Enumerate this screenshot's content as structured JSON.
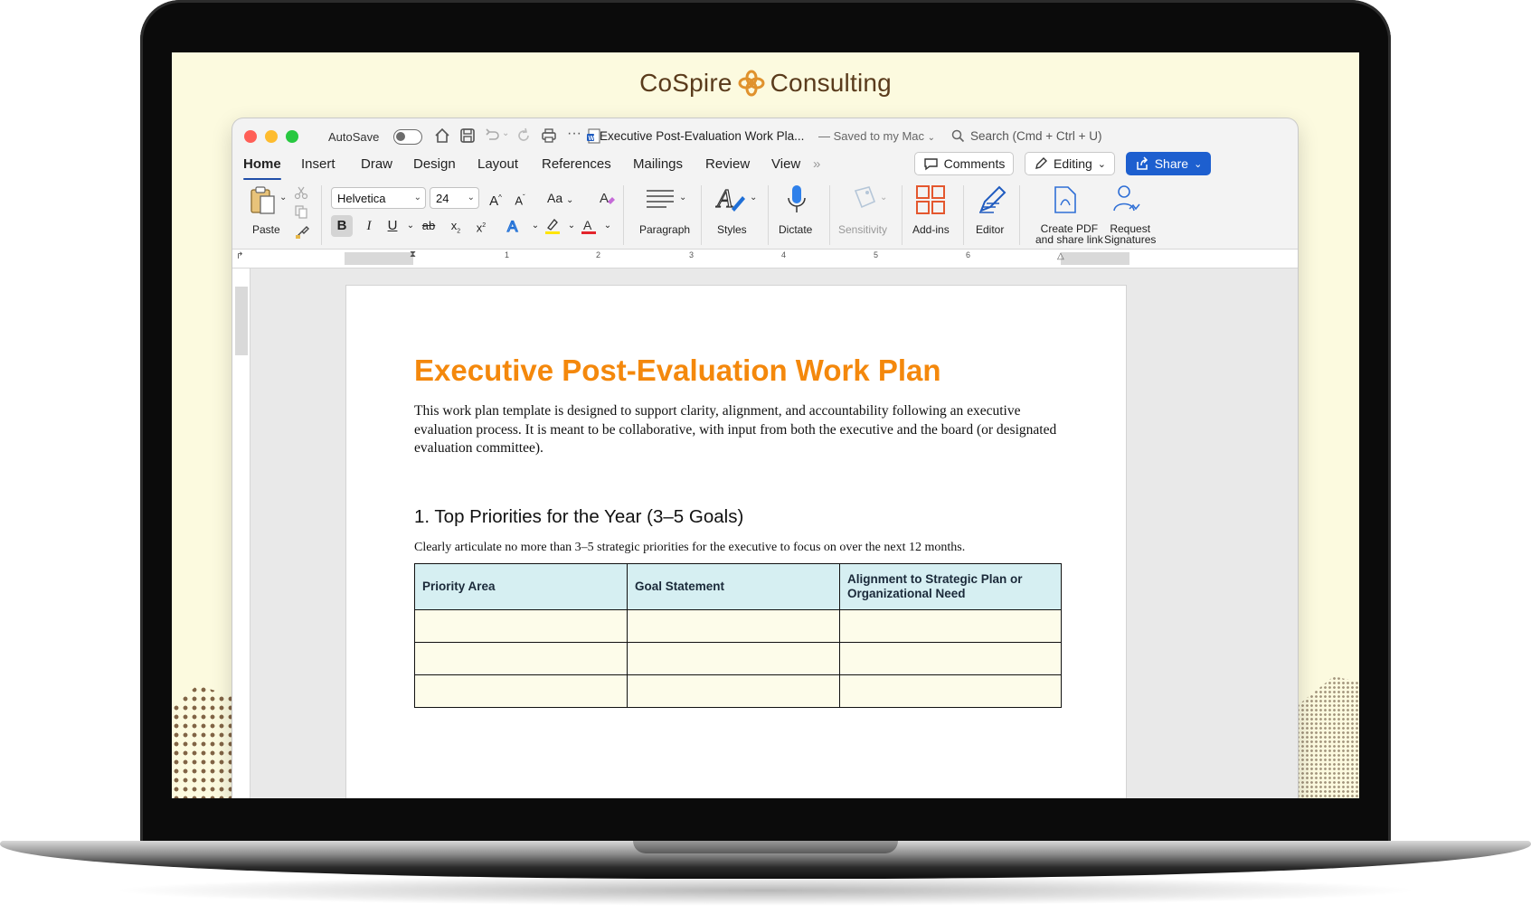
{
  "brand": {
    "name_left": "CoSpire",
    "name_right": "Consulting"
  },
  "window": {
    "autosave_label": "AutoSave",
    "doc_title": "Executive Post-Evaluation Work Pla...",
    "saved_state": "— Saved to my Mac",
    "search_placeholder": "Search (Cmd + Ctrl + U)"
  },
  "tabs": {
    "items": [
      {
        "label": "Home"
      },
      {
        "label": "Insert"
      },
      {
        "label": "Draw"
      },
      {
        "label": "Design"
      },
      {
        "label": "Layout"
      },
      {
        "label": "References"
      },
      {
        "label": "Mailings"
      },
      {
        "label": "Review"
      },
      {
        "label": "View"
      }
    ],
    "active": "Home",
    "more": "»"
  },
  "actions": {
    "comments_label": "Comments",
    "editing_label": "Editing",
    "share_label": "Share"
  },
  "ribbon": {
    "paste_label": "Paste",
    "font_name": "Helvetica",
    "font_size": "24",
    "grow_font": "A",
    "shrink_font": "A",
    "change_case": "Aa",
    "bold": "B",
    "italic": "I",
    "underline": "U",
    "strikethrough": "ab",
    "subscript": "x",
    "superscript": "x",
    "paragraph_label": "Paragraph",
    "styles_label": "Styles",
    "dictate_label": "Dictate",
    "sensitivity_label": "Sensitivity",
    "addins_label": "Add-ins",
    "editor_label": "Editor",
    "create_pdf_label_1": "Create PDF",
    "create_pdf_label_2": "and share link",
    "request_sig_label_1": "Request",
    "request_sig_label_2": "Signatures"
  },
  "ruler": {
    "numbers": [
      "1",
      "2",
      "3",
      "4",
      "5",
      "6"
    ]
  },
  "document": {
    "heading": "Executive Post-Evaluation Work Plan",
    "intro": "This work plan template is designed to support clarity, alignment, and accountability following an executive evaluation process. It is meant to be collaborative, with input from both the executive and the board (or designated evaluation committee).",
    "section_heading": "1. Top Priorities for the Year (3–5 Goals)",
    "section_desc": "Clearly articulate no more than 3–5 strategic priorities for the executive to focus on over the next 12 months.",
    "table": {
      "headers": [
        "Priority Area",
        "Goal Statement",
        "Alignment to Strategic Plan or Organizational Need"
      ],
      "rows": [
        [
          "",
          "",
          ""
        ],
        [
          "",
          "",
          ""
        ],
        [
          "",
          "",
          ""
        ]
      ]
    }
  },
  "colors": {
    "heading_orange": "#f4880c",
    "table_header_bg": "#d6eff2",
    "table_cell_bg": "#fdfcea",
    "share_blue": "#1d5fcf",
    "screen_bg": "#fcfadf",
    "brand_brown": "#5a3b1c"
  }
}
